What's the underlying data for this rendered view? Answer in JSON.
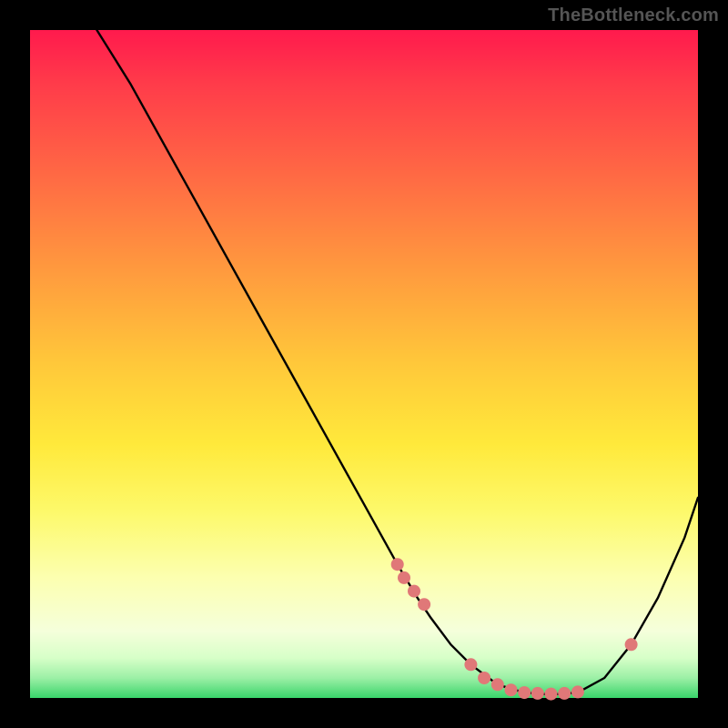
{
  "watermark": "TheBottleneck.com",
  "chart_data": {
    "type": "line",
    "title": "",
    "xlabel": "",
    "ylabel": "",
    "xlim": [
      0,
      100
    ],
    "ylim": [
      0,
      100
    ],
    "grid": false,
    "legend": false,
    "series": [
      {
        "name": "curve",
        "color": "#000000",
        "x": [
          10,
          15,
          20,
          25,
          30,
          35,
          40,
          45,
          50,
          55,
          58,
          60,
          63,
          66,
          70,
          74,
          78,
          82,
          86,
          90,
          94,
          98,
          100
        ],
        "values": [
          100,
          92,
          83,
          74,
          65,
          56,
          47,
          38,
          29,
          20,
          15,
          12,
          8,
          5,
          2,
          0.8,
          0.5,
          0.8,
          3,
          8,
          15,
          24,
          30
        ]
      }
    ],
    "markers": {
      "name": "highlight-points",
      "color": "#e07878",
      "radius_px": 7,
      "x": [
        55,
        56,
        57.5,
        59,
        66,
        68,
        70,
        72,
        74,
        76,
        78,
        80,
        82,
        90
      ],
      "values": [
        20,
        18,
        16,
        14,
        5,
        3,
        2,
        1.2,
        0.8,
        0.7,
        0.6,
        0.7,
        0.9,
        8
      ]
    }
  }
}
